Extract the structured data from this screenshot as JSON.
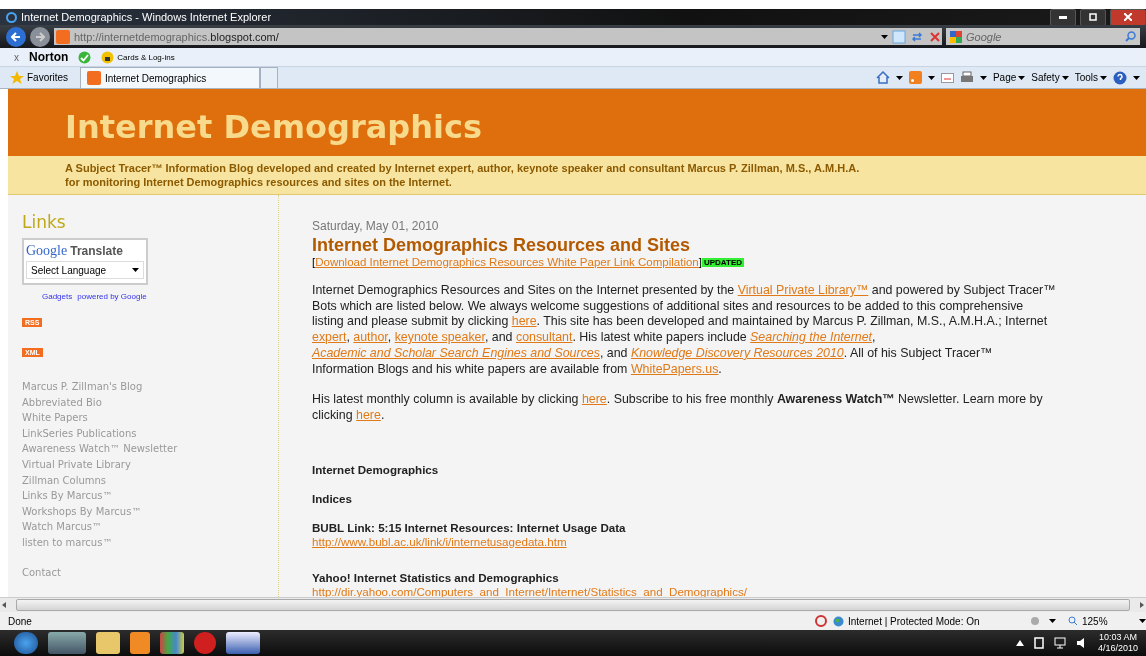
{
  "window": {
    "title": "Internet Demographics - Windows Internet Explorer"
  },
  "address_bar": {
    "url_prefix": "http://internetdemographics.",
    "url_domain": "blogspot.com/",
    "search_placeholder": "Google"
  },
  "norton_bar": {
    "close": "x",
    "brand": "Norton",
    "cards": "Cards & Log-ins"
  },
  "tabs": [
    {
      "label": "Internet Demographics",
      "selected": true
    }
  ],
  "favorites": "Favorites",
  "command_bar": [
    "Page",
    "Safety",
    "Tools"
  ],
  "blog": {
    "title": "Internet Demographics",
    "tagline": [
      "A Subject Tracer™ Information Blog developed and created by Internet expert, author, keynote speaker and consultant Marcus P. Zillman, M.S., A.M.H.A.",
      "for monitoring Internet Demographics resources and sites on the Internet."
    ]
  },
  "sidebar": {
    "heading": "Links",
    "translate": {
      "brand": "Google",
      "label": "Translate",
      "select": "Select Language",
      "gadgets": "Gadgets",
      "powered": "powered by Google"
    },
    "feed_badges": [
      "RSS",
      "XML"
    ],
    "links": [
      {
        "label": "Marcus P. Zillman's Blog"
      },
      {
        "label": "Abbreviated Bio"
      },
      {
        "label": "White Papers"
      },
      {
        "label": "LinkSeries Publications"
      },
      {
        "label": "Awareness Watch™ Newsletter"
      },
      {
        "label": "Virtual Private Library"
      },
      {
        "label": "Zillman Columns"
      },
      {
        "label": "Links By Marcus™"
      },
      {
        "label": "Workshops By Marcus™"
      },
      {
        "label": "Watch Marcus™"
      },
      {
        "label": "listen to marcus™"
      }
    ],
    "contact": "Contact"
  },
  "post": {
    "date": "Saturday, May 01, 2010",
    "title": "Internet Demographics Resources and Sites",
    "download": {
      "open": "[",
      "link": "Download Internet Demographics Resources White Paper Link Compilation",
      "close": "]",
      "badge": "UPDATED"
    },
    "paragraphs": [
      [
        {
          "kind": "text",
          "text": "Internet Demographics Resources and Sites on the Internet presented by the "
        },
        {
          "kind": "link",
          "text": "Virtual Private Library™"
        },
        {
          "kind": "text",
          "text": " and powered by Subject Tracer™ Bots which are listed below. We always welcome suggestions of additional sites and resources to be added to this comprehensive listing and please submit by clicking "
        },
        {
          "kind": "link",
          "text": "here"
        },
        {
          "kind": "text",
          "text": ". This site has been developed and maintained by Marcus P. Zillman, M.S., A.M.H.A.; Internet "
        },
        {
          "kind": "link",
          "text": "expert"
        },
        {
          "kind": "text",
          "text": ", "
        },
        {
          "kind": "link",
          "text": "author"
        },
        {
          "kind": "text",
          "text": ", "
        },
        {
          "kind": "link",
          "text": "keynote speaker"
        },
        {
          "kind": "text",
          "text": ", and "
        },
        {
          "kind": "link",
          "text": "consultant"
        },
        {
          "kind": "text",
          "text": ". His latest white papers include "
        },
        {
          "kind": "italic_link",
          "text": "Searching the Internet"
        },
        {
          "kind": "text",
          "text": ", "
        },
        {
          "kind": "italic_link",
          "text": "Academic and Scholar Search Engines and Sources"
        },
        {
          "kind": "text",
          "text": ", and "
        },
        {
          "kind": "italic_link",
          "text": "Knowledge Discovery Resources 2010"
        },
        {
          "kind": "text",
          "text": ". All of his Subject Tracer™ Information Blogs and his white papers are available from "
        },
        {
          "kind": "link",
          "text": "WhitePapers.us"
        },
        {
          "kind": "text",
          "text": "."
        }
      ],
      [
        {
          "kind": "text",
          "text": "His latest monthly column is available by clicking "
        },
        {
          "kind": "link",
          "text": "here"
        },
        {
          "kind": "text",
          "text": ". Subscribe to his free monthly **Awareness Watch™** Newsletter. Learn more by clicking "
        },
        {
          "kind": "link",
          "text": "here"
        },
        {
          "kind": "text",
          "text": "."
        }
      ]
    ],
    "sections": [
      "Internet Demographics",
      "Indices"
    ],
    "entries": [
      {
        "title": "BUBL Link: 5:15 Internet Resources: Internet Usage Data",
        "url": "http://www.bubl.ac.uk/link/i/internetusagedata.htm"
      },
      {
        "title": "Yahoo! Internet Statistics and Demographics",
        "url": "http://dir.yahoo.com/Computers_and_Internet/Internet/Statistics_and_Demographics/"
      }
    ]
  },
  "status_bar": {
    "status": "Done",
    "zone": "Internet | Protected Mode: On",
    "zoom": "125%"
  },
  "taskbar": {
    "time": "10:03 AM",
    "date": "4/16/2010"
  }
}
